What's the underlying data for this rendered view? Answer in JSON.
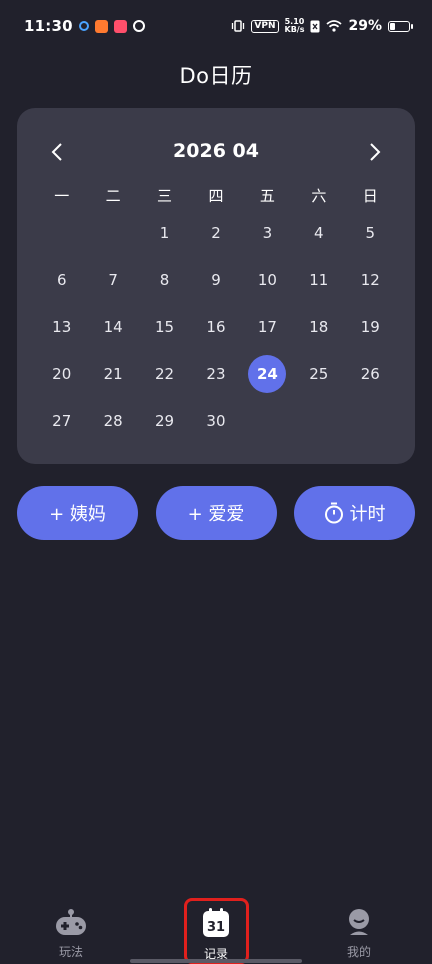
{
  "status_bar": {
    "time": "11:30",
    "vpn": "VPN",
    "speed_value": "5.10",
    "speed_unit": "KB/s",
    "battery_percent": "29%",
    "battery_level": 0.29
  },
  "header": {
    "title": "Do日历"
  },
  "calendar": {
    "month_label": "2026 04",
    "weekdays": [
      "一",
      "二",
      "三",
      "四",
      "五",
      "六",
      "日"
    ],
    "weeks": [
      [
        "",
        "",
        "1",
        "2",
        "3",
        "4",
        "5"
      ],
      [
        "6",
        "7",
        "8",
        "9",
        "10",
        "11",
        "12"
      ],
      [
        "13",
        "14",
        "15",
        "16",
        "17",
        "18",
        "19"
      ],
      [
        "20",
        "21",
        "22",
        "23",
        "24",
        "25",
        "26"
      ],
      [
        "27",
        "28",
        "29",
        "30",
        "",
        "",
        ""
      ]
    ],
    "selected_day": "24",
    "accent_color": "#6171ea"
  },
  "actions": {
    "period_label": "+ 姨妈",
    "love_label": "+ 爱爱",
    "timer_label": "计时"
  },
  "bottom_nav": {
    "items": [
      {
        "label": "玩法",
        "icon": "gamepad-icon"
      },
      {
        "label": "记录",
        "icon": "calendar-31-icon",
        "icon_text": "31"
      },
      {
        "label": "我的",
        "icon": "profile-icon"
      }
    ],
    "active_index": 1
  }
}
